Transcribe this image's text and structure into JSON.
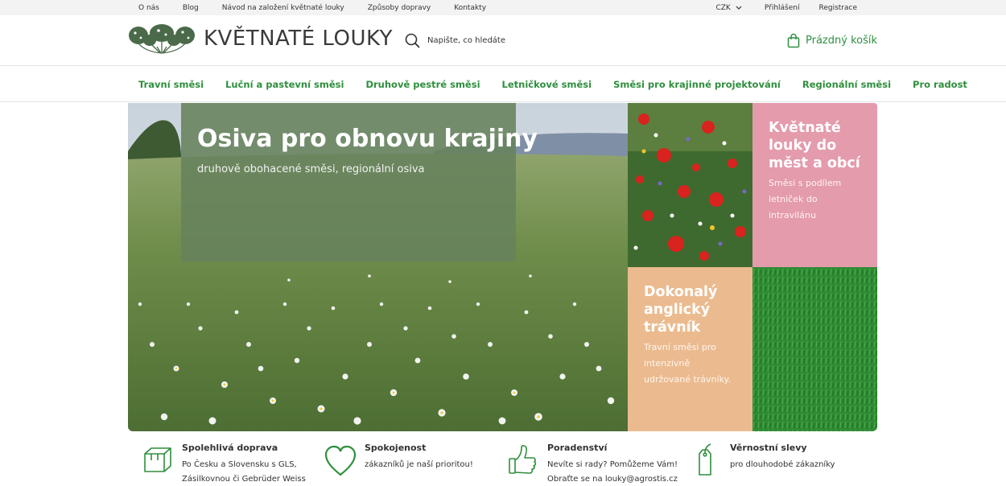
{
  "topbar": {
    "links": [
      "O nás",
      "Blog",
      "Návod na založení květnaté louky",
      "Způsoby dopravy",
      "Kontakty"
    ],
    "currency": "CZK",
    "login": "Přihlášení",
    "register": "Registrace"
  },
  "header": {
    "logo_text": "KVĚTNATÉ LOUKY",
    "search_placeholder": "Napište, co hledáte",
    "cart_label": "Prázdný košík"
  },
  "nav": {
    "items": [
      "Travní směsi",
      "Luční a pastevní směsi",
      "Druhově pestré směsi",
      "Letničkové směsi",
      "Směsi pro krajinné projektování",
      "Regionální směsi",
      "Pro radost"
    ]
  },
  "hero": {
    "title": "Osiva pro obnovu krajiny",
    "subtitle": "druhově obohacené směsi, regionální osiva"
  },
  "tiles": {
    "pink": {
      "title": "Květnaté louky do měst a obcí",
      "text": "Směsi s podílem letniček do intravilánu",
      "color": "#e49bac"
    },
    "peach": {
      "title": "Dokonalý anglický trávník",
      "text": "Travní směsi pro intenzivně udržované trávníky.",
      "color": "#ebbb8f"
    }
  },
  "benefits": [
    {
      "title": "Spolehlivá doprava",
      "line1": "Po Česku a Slovensku s GLS,",
      "line2": "Zásilkovnou či Gebrüder Weiss",
      "icon": "box-icon"
    },
    {
      "title": "Spokojenost",
      "line1": "zákazníků je naší prioritou!",
      "line2": "",
      "icon": "heart-icon"
    },
    {
      "title": "Poradenství",
      "line1": "Nevíte si rady? Pomůžeme Vám!",
      "line2": "Obraťte se na louky@agrostis.cz",
      "icon": "thumbs-up-icon"
    },
    {
      "title": "Věrnostní slevy",
      "line1": "pro dlouhodobé zákazníky",
      "line2": "",
      "icon": "price-tag-icon"
    }
  ],
  "colors": {
    "brand_green": "#2e8f3d",
    "overlay_green": "#66825c"
  }
}
